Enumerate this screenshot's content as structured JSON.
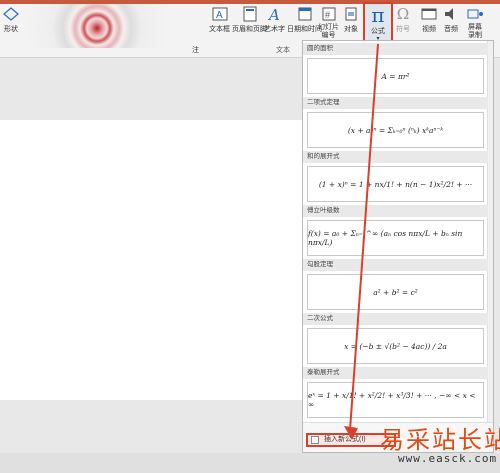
{
  "ribbon": {
    "shape_label": "形状",
    "textbox_label": "文本框",
    "header_footer_label": "页眉和页脚",
    "wordart_label": "艺术字",
    "datetime_label": "日期和时间",
    "slide_number_label": "幻灯片\n编号",
    "object_label": "对象",
    "group_text": "文本",
    "formula_label": "公式",
    "symbol_label": "符号",
    "video_label": "视频",
    "audio_label": "音频",
    "screen_record_label": "屏幕\n录制",
    "group_left_partial": "注"
  },
  "dropdown": {
    "sections": [
      {
        "title": "圆的面积",
        "equation": "A = πr²"
      },
      {
        "title": "二项式定理",
        "equation": "(x + a)ⁿ = Σₖ₌₀ⁿ (ⁿₖ) xᵏaⁿ⁻ᵏ"
      },
      {
        "title": "和的展开式",
        "equation": "(1 + x)ⁿ = 1 + nx/1! + n(n − 1)x²/2! + ···"
      },
      {
        "title": "傅立叶级数",
        "equation": "f(x) = a₀ + Σₙ₌₁^∞ (aₙ cos nπx/L + bₙ sin nπx/L)"
      },
      {
        "title": "勾股定理",
        "equation": "a² + b² = c²"
      },
      {
        "title": "二次公式",
        "equation": "x = (−b ± √(b² − 4ac)) / 2a"
      },
      {
        "title": "泰勒展开式",
        "equation": "eˣ = 1 + x/1! + x²/2! + x³/3! + ··· ,   −∞ < x < ∞"
      }
    ],
    "insert_new_label": "插入新公式(I)"
  },
  "watermark": {
    "site_name": "易采站长站",
    "url": "www.easck.com"
  },
  "colors": {
    "highlight_red": "#d9402b",
    "formula_pi_blue": "#1e5fb0",
    "watermark_orange": "#e04b14"
  }
}
